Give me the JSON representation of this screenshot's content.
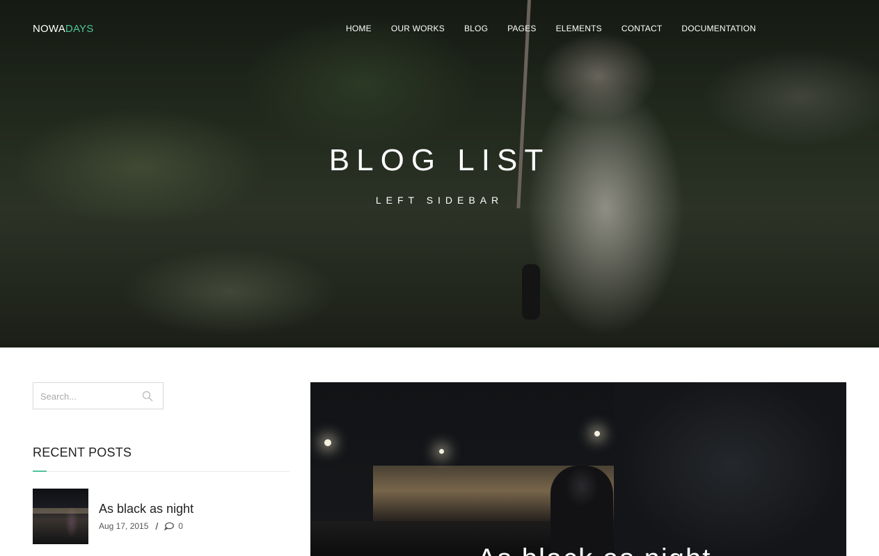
{
  "logo": {
    "part1": "NOWA",
    "part2": "DAYS"
  },
  "nav": {
    "items": [
      "HOME",
      "OUR WORKS",
      "BLOG",
      "PAGES",
      "ELEMENTS",
      "CONTACT",
      "DOCUMENTATION"
    ]
  },
  "hero": {
    "title": "BLOG LIST",
    "subtitle": "LEFT SIDEBAR"
  },
  "sidebar": {
    "search": {
      "placeholder": "Search...",
      "icon": "search-icon"
    },
    "recent_posts": {
      "title": "RECENT POSTS",
      "items": [
        {
          "title": "As black as night",
          "date": "Aug 17, 2015",
          "separator": "/",
          "comments": "0",
          "icon": "comment-icon"
        }
      ]
    }
  },
  "feature": {
    "title": "As black as night"
  },
  "colors": {
    "accent": "#4fc59a",
    "text": "#1f1f1f",
    "white": "#ffffff"
  }
}
